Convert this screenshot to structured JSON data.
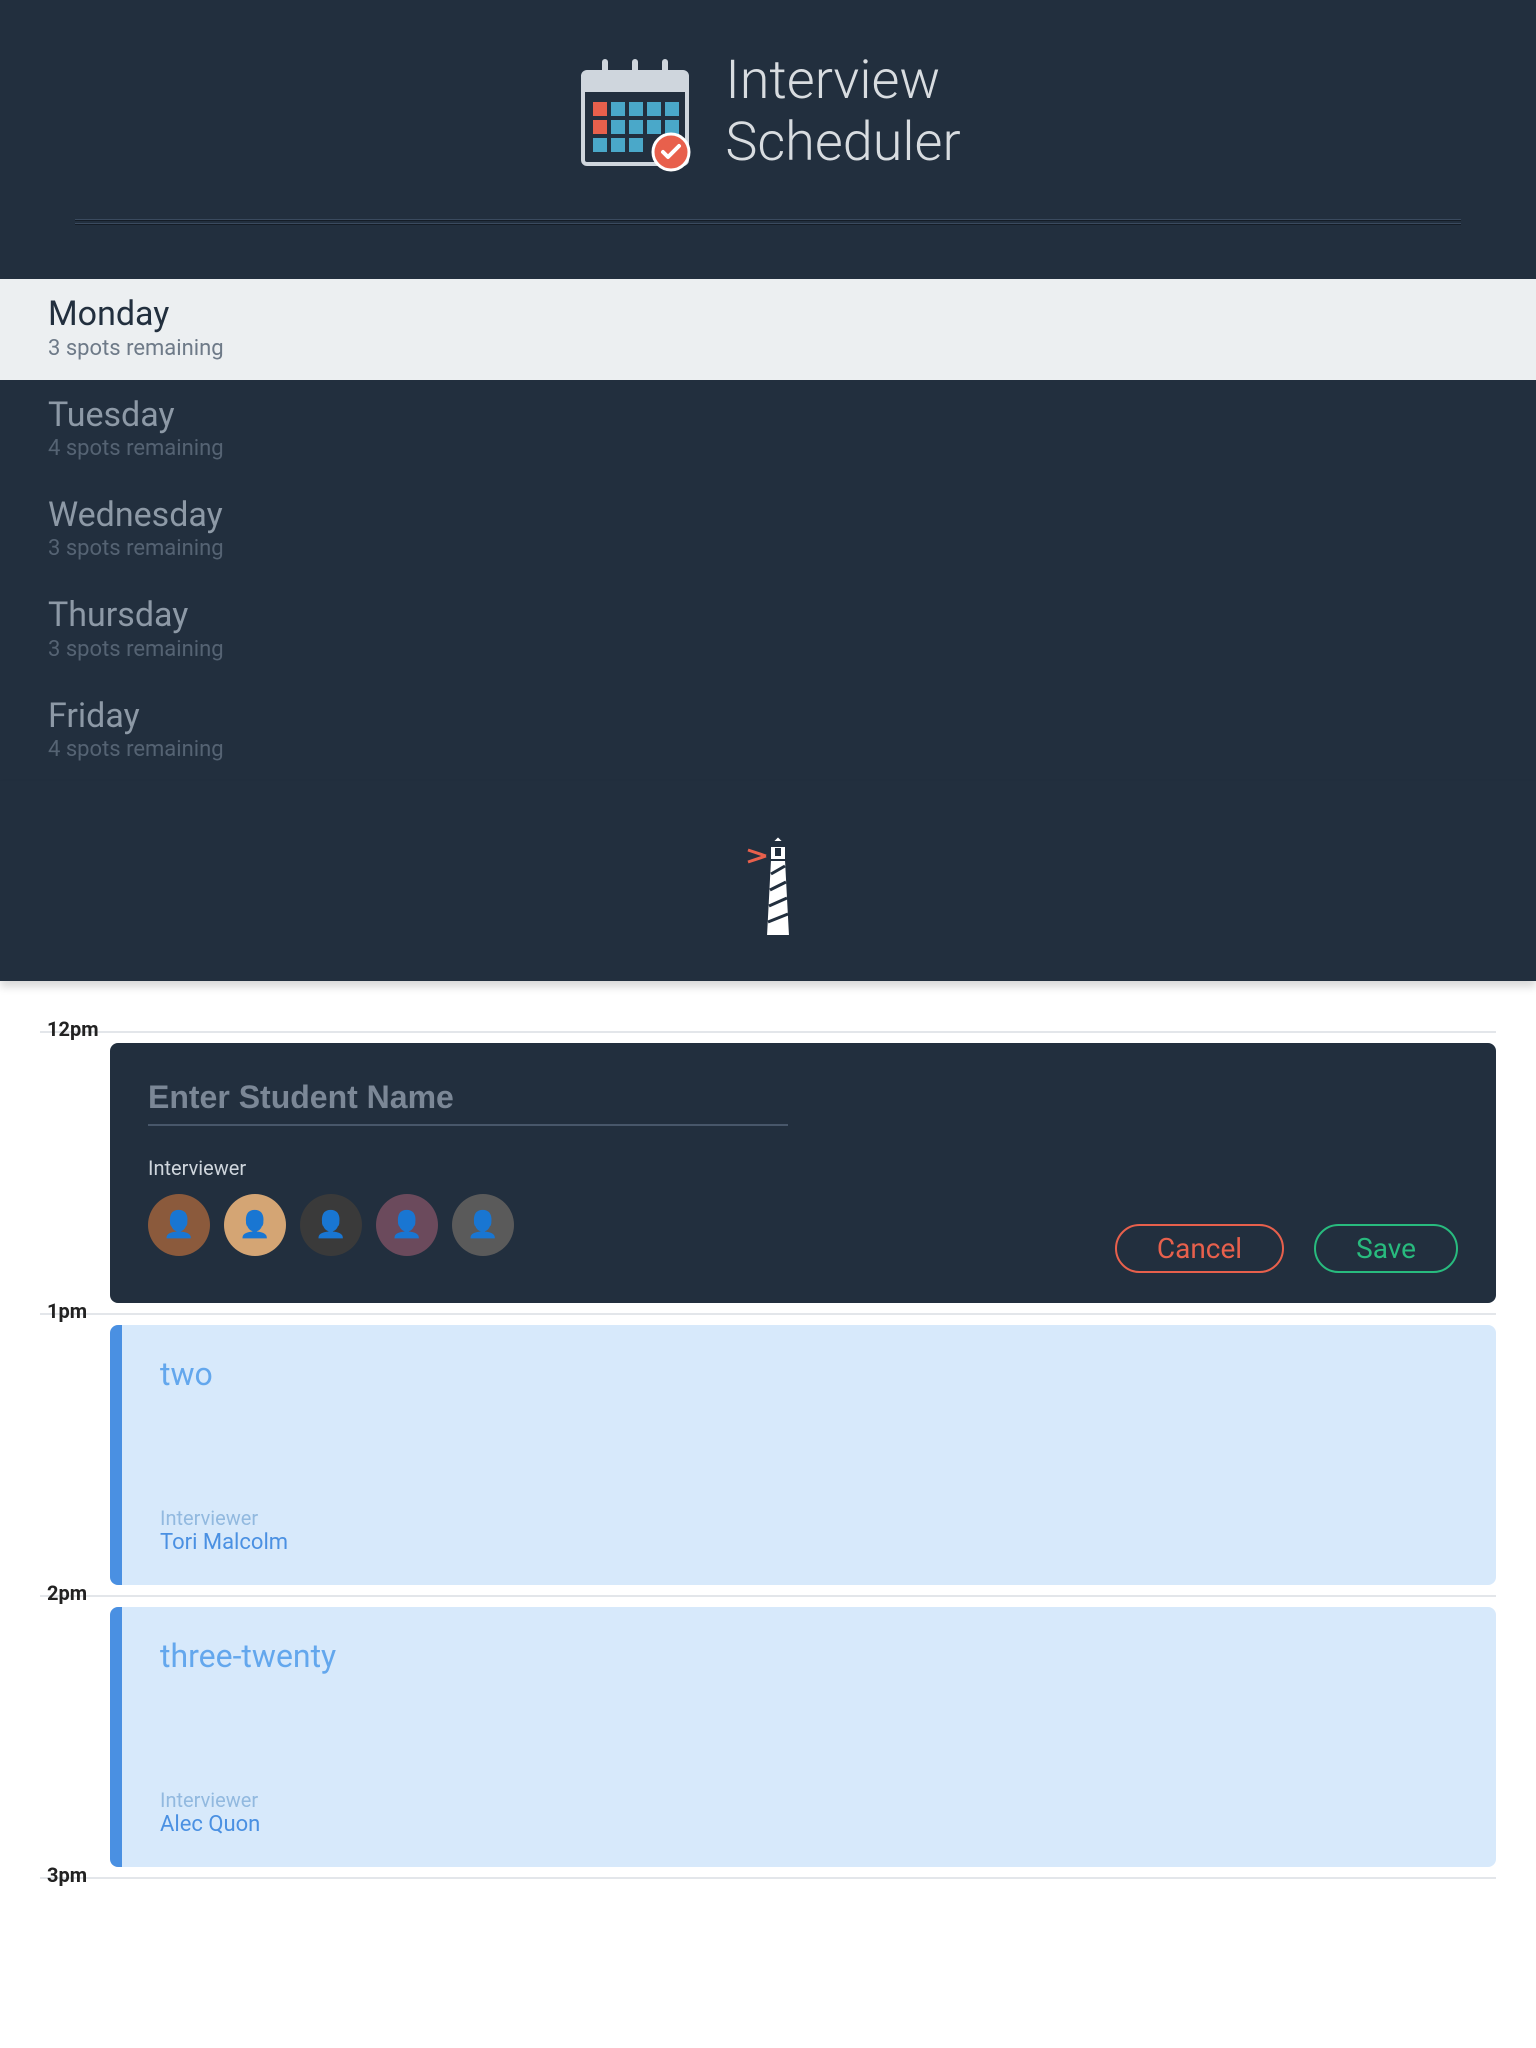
{
  "header": {
    "title_line1": "Interview",
    "title_line2": "Scheduler"
  },
  "days": [
    {
      "name": "Monday",
      "spots": "3 spots remaining",
      "selected": true
    },
    {
      "name": "Tuesday",
      "spots": "4 spots remaining",
      "selected": false
    },
    {
      "name": "Wednesday",
      "spots": "3 spots remaining",
      "selected": false
    },
    {
      "name": "Thursday",
      "spots": "3 spots remaining",
      "selected": false
    },
    {
      "name": "Friday",
      "spots": "4 spots remaining",
      "selected": false
    }
  ],
  "form": {
    "placeholder": "Enter Student Name",
    "interviewer_label": "Interviewer",
    "cancel_label": "Cancel",
    "save_label": "Save",
    "avatar_colors": [
      "#8b5a3c",
      "#d4a574",
      "#3a3a3a",
      "#6b4a5c",
      "#5a5a5a"
    ]
  },
  "slots": [
    {
      "time": "12pm",
      "type": "form"
    },
    {
      "time": "1pm",
      "type": "booked",
      "student": "two",
      "interviewer_label": "Interviewer",
      "interviewer": "Tori Malcolm"
    },
    {
      "time": "2pm",
      "type": "booked",
      "student": "three-twenty",
      "interviewer_label": "Interviewer",
      "interviewer": "Alec Quon"
    },
    {
      "time": "3pm",
      "type": "end"
    }
  ]
}
